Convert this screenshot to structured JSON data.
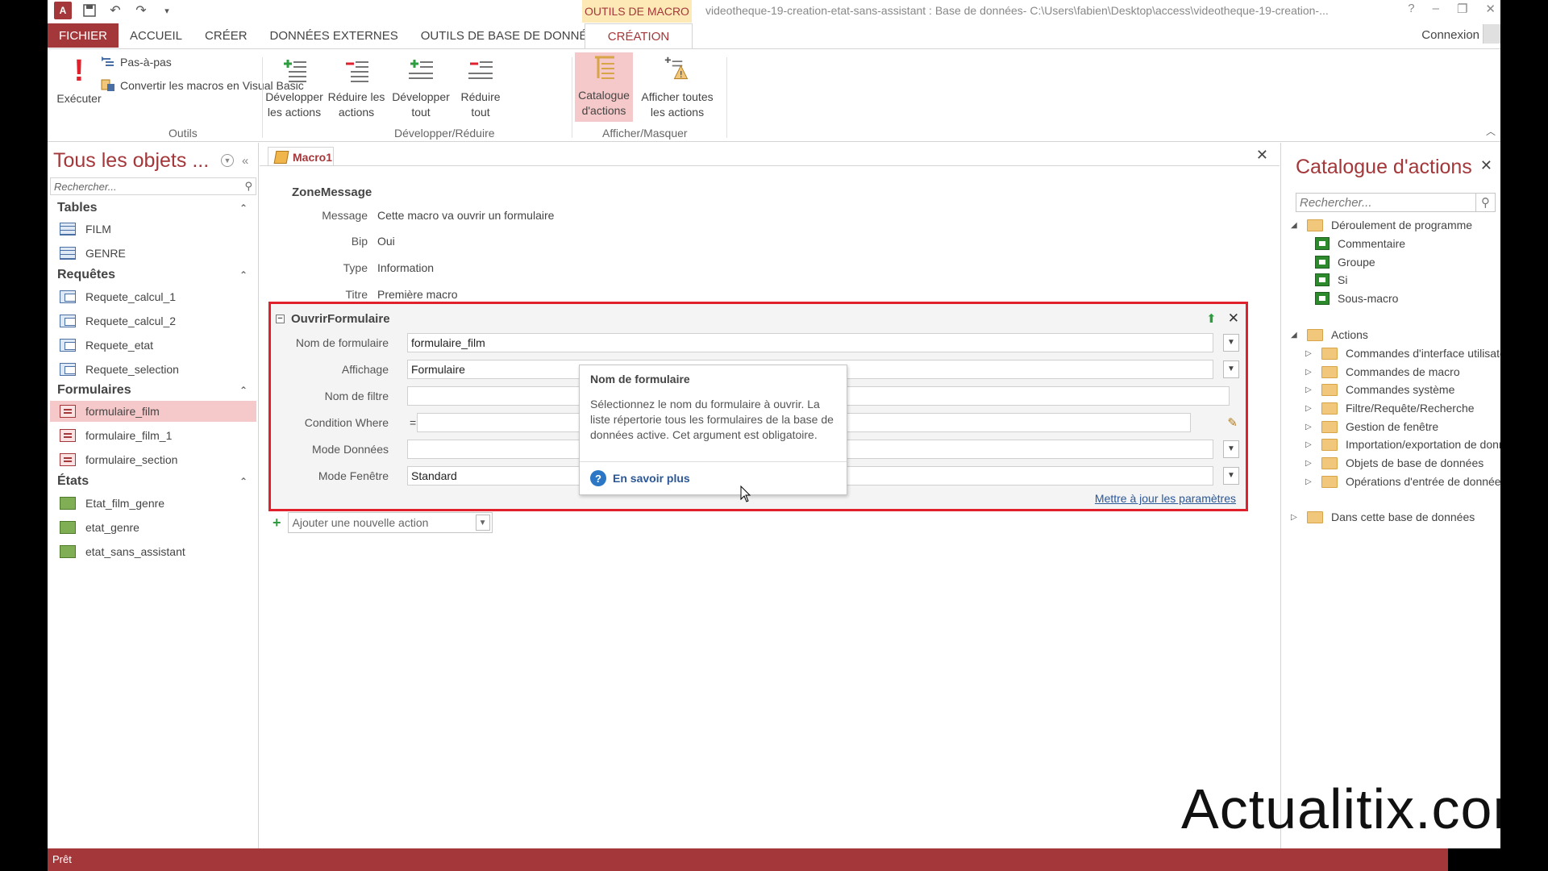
{
  "titlebar": {
    "app_logo": "A",
    "context_tab": "OUTILS DE MACRO",
    "window_title": "videotheque-19-creation-etat-sans-assistant : Base de données- C:\\Users\\fabien\\Desktop\\access\\videotheque-19-creation-...",
    "help": "?",
    "minimize": "–",
    "restore": "❐",
    "close": "✕"
  },
  "tabs": [
    "FICHIER",
    "ACCUEIL",
    "CRÉER",
    "DONNÉES EXTERNES",
    "OUTILS DE BASE DE DONNÉES"
  ],
  "active_tab": "CRÉATION",
  "connexion": "Connexion",
  "ribbon": {
    "executer": "Exécuter",
    "pas_a_pas": "Pas-à-pas",
    "convertir": "Convertir les macros en Visual Basic",
    "group_outils": "Outils",
    "developper_actions": "Développer les actions",
    "reduire_actions": "Réduire les actions",
    "developper_tout": "Développer tout",
    "reduire_tout": "Réduire tout",
    "group_dev_red": "Développer/Réduire",
    "catalogue_actions": "Catalogue d'actions",
    "afficher_toutes": "Afficher toutes les actions",
    "group_afficher": "Afficher/Masquer"
  },
  "nav": {
    "title": "Tous les objets ...",
    "search_placeholder": "Rechercher...",
    "sections": [
      {
        "label": "Tables",
        "items": [
          "FILM",
          "GENRE"
        ]
      },
      {
        "label": "Requêtes",
        "items": [
          "Requete_calcul_1",
          "Requete_calcul_2",
          "Requete_etat",
          "Requete_selection"
        ]
      },
      {
        "label": "Formulaires",
        "items": [
          "formulaire_film",
          "formulaire_film_1",
          "formulaire_section"
        ]
      },
      {
        "label": "États",
        "items": [
          "Etat_film_genre",
          "etat_genre",
          "etat_sans_assistant"
        ]
      }
    ]
  },
  "doc": {
    "tab": "Macro1",
    "zonemessage": {
      "title": "ZoneMessage",
      "rows": [
        {
          "k": "Message",
          "v": "Cette macro va ouvrir un formulaire"
        },
        {
          "k": "Bip",
          "v": "Oui"
        },
        {
          "k": "Type",
          "v": "Information"
        },
        {
          "k": "Titre",
          "v": "Première macro"
        }
      ]
    },
    "ouvrir": {
      "title": "OuvrirFormulaire",
      "nom_label": "Nom de formulaire",
      "nom_value": "formulaire_film",
      "affichage_label": "Affichage",
      "affichage_value": "Formulaire",
      "filtre_label": "Nom de filtre",
      "where_label": "Condition Where",
      "where_eq": "=",
      "donnees_label": "Mode Données",
      "fenetre_label": "Mode Fenêtre",
      "fenetre_value": "Standard",
      "update_link": "Mettre à jour les paramètres"
    },
    "tooltip": {
      "title": "Nom de formulaire",
      "body": "Sélectionnez le nom du formulaire à ouvrir. La liste répertorie tous les formulaires de la base de données active. Cet argument est obligatoire.",
      "more": "En savoir plus"
    },
    "add_action": "Ajouter une nouvelle action"
  },
  "catalog": {
    "title": "Catalogue d'actions",
    "search_placeholder": "Rechercher...",
    "deroulement": "Déroulement de programme",
    "deroulement_items": [
      "Commentaire",
      "Groupe",
      "Si",
      "Sous-macro"
    ],
    "actions": "Actions",
    "actions_items": [
      "Commandes d'interface utilisateur",
      "Commandes de macro",
      "Commandes système",
      "Filtre/Requête/Recherche",
      "Gestion de fenêtre",
      "Importation/exportation de données",
      "Objets de base de données",
      "Opérations d'entrée de données"
    ],
    "dans_base": "Dans cette base de données"
  },
  "status": "Prêt",
  "watermark": "Actualitix.com",
  "colors": {
    "accent": "#a4373a",
    "highlight": "#f5c8c9",
    "red_frame": "#e0202b",
    "link": "#2b5797"
  }
}
